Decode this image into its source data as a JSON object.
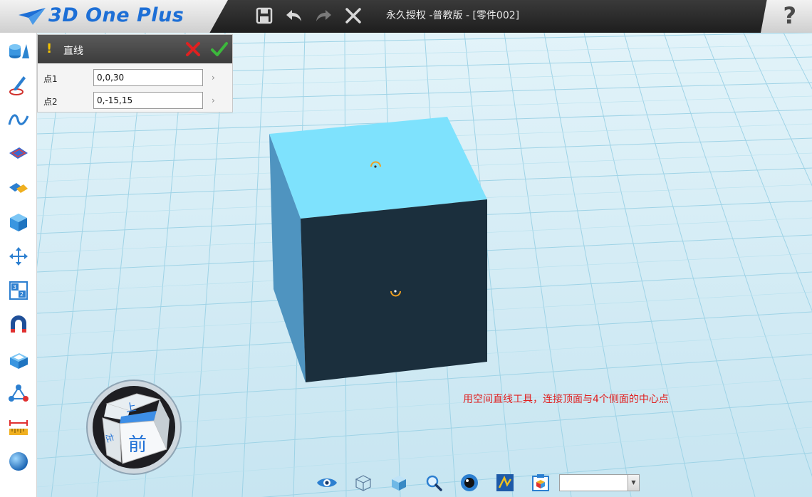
{
  "app": {
    "name": "3D One Plus",
    "document_title": "永久授权 -普教版 - [零件002]"
  },
  "titlebar": {
    "buttons": [
      "save-icon",
      "undo-icon",
      "redo-icon",
      "close-icon"
    ],
    "help_label": "?"
  },
  "left_toolbar": {
    "items": [
      "basic-shapes-icon",
      "sketch-pen-icon",
      "curve-icon",
      "sketch-edit-icon",
      "feature-modify-icon",
      "special-function-icon",
      "move-icon",
      "combine-icon",
      "magnet-icon",
      "shell-icon",
      "pattern-icon",
      "measure-icon",
      "material-sphere-icon"
    ]
  },
  "command_panel": {
    "warning_symbol": "!",
    "title": "直线",
    "fields": [
      {
        "label": "点1",
        "value": "0,0,30"
      },
      {
        "label": "点2",
        "value": "0,-15,15"
      }
    ],
    "arrow": "›"
  },
  "annotation": "用空间直线工具，连接顶面与4个侧面的中心点",
  "viewcube": {
    "top_label": "上",
    "front_label": "前",
    "left_label": "左"
  },
  "bottom_toolbar": {
    "items": [
      "eye-icon",
      "wireframe-cube-icon",
      "shaded-cube-icon",
      "zoom-icon",
      "render-icon",
      "sketch-mode-icon",
      "snapshot-icon"
    ],
    "select_value": ""
  },
  "colors": {
    "cube_top": "#7ee2fd",
    "cube_front": "#1b2f3d",
    "cube_side": "#4f94c0",
    "annotation": "#e02020",
    "logo": "#1d6fd6"
  }
}
